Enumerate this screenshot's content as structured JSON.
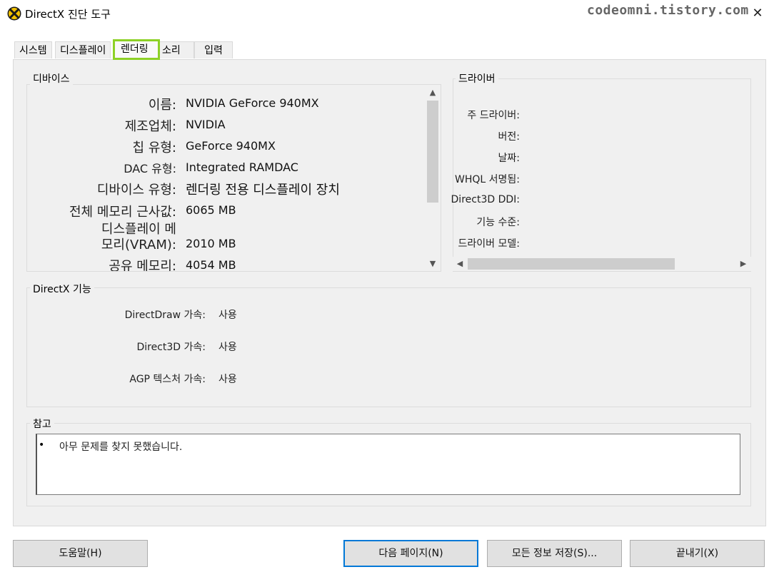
{
  "window": {
    "title": "DirectX 진단 도구",
    "watermark": "codeomni.tistory.com",
    "close_glyph": "✕"
  },
  "tabs": [
    {
      "label": "시스템"
    },
    {
      "label": "디스플레이"
    },
    {
      "label": "렌더링",
      "active": true
    },
    {
      "label": "소리"
    },
    {
      "label": "입력"
    }
  ],
  "device": {
    "title": "디바이스",
    "rows": [
      {
        "label": "이름:",
        "value": "NVIDIA GeForce 940MX"
      },
      {
        "label": "제조업체:",
        "value": "NVIDIA"
      },
      {
        "label": "칩 유형:",
        "value": "GeForce 940MX"
      },
      {
        "label": "DAC 유형:",
        "value": "Integrated RAMDAC"
      },
      {
        "label": "디바이스 유형:",
        "value": "렌더링 전용 디스플레이 장치"
      },
      {
        "label": "전체 메모리 근사값:",
        "value": "6065 MB"
      },
      {
        "label_line1": "디스플레이 메",
        "label_line2": "모리(VRAM):",
        "value": "2010 MB"
      },
      {
        "label": "공유 메모리:",
        "value": "4054 MB"
      }
    ]
  },
  "driver": {
    "title": "드라이버",
    "rows": [
      {
        "label": "주 드라이버:"
      },
      {
        "label": "버전:"
      },
      {
        "label": "날짜:"
      },
      {
        "label": "WHQL 서명됨:"
      },
      {
        "label": "Direct3D DDI:"
      },
      {
        "label": "기능 수준:"
      },
      {
        "label": "드라이버 모델:"
      }
    ]
  },
  "features": {
    "title": "DirectX 기능",
    "rows": [
      {
        "label": "DirectDraw 가속:",
        "value": "사용"
      },
      {
        "label": "Direct3D 가속:",
        "value": "사용"
      },
      {
        "label": "AGP 텍스처 가속:",
        "value": "사용"
      }
    ]
  },
  "notes": {
    "title": "참고",
    "bullet": "•",
    "items": [
      "아무 문제를 찾지 못했습니다."
    ]
  },
  "buttons": {
    "help": "도움말(H)",
    "next_page": "다음 페이지(N)",
    "save_all": "모든 정보 저장(S)...",
    "exit": "끝내기(X)"
  },
  "colors": {
    "active_tab_highlight": "#8dd126",
    "default_button_border": "#0078d7",
    "panel_background": "#f0f0f0"
  },
  "icons": {
    "app": "directx-icon",
    "scroll_up": "▲",
    "scroll_down": "▼",
    "scroll_left": "◀",
    "scroll_right": "▶"
  }
}
